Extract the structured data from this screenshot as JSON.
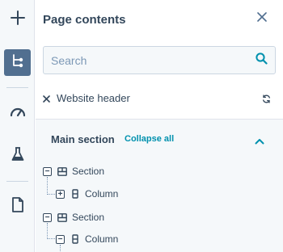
{
  "rail": {
    "items": [
      {
        "name": "add",
        "icon": "plus-icon"
      },
      {
        "name": "page-contents",
        "icon": "tree-structure-icon",
        "active": true
      },
      {
        "name": "performance",
        "icon": "gauge-icon"
      },
      {
        "name": "test",
        "icon": "flask-icon"
      },
      {
        "name": "page",
        "icon": "document-icon"
      }
    ]
  },
  "panel": {
    "title": "Page contents",
    "search_placeholder": "Search",
    "header_item": "Website header",
    "main_section": {
      "title": "Main section",
      "collapse_label": "Collapse all"
    },
    "tree": [
      {
        "label": "Section",
        "toggle": "−",
        "icon": "section-layout-icon"
      },
      {
        "label": "Column",
        "toggle": "+",
        "icon": "column-icon"
      },
      {
        "label": "Section",
        "toggle": "−",
        "icon": "section-layout-icon"
      },
      {
        "label": "Column",
        "toggle": "−",
        "icon": "column-icon"
      }
    ]
  },
  "colors": {
    "accent": "#0091ae",
    "rail_active": "#516f90",
    "text": "#33475b"
  }
}
